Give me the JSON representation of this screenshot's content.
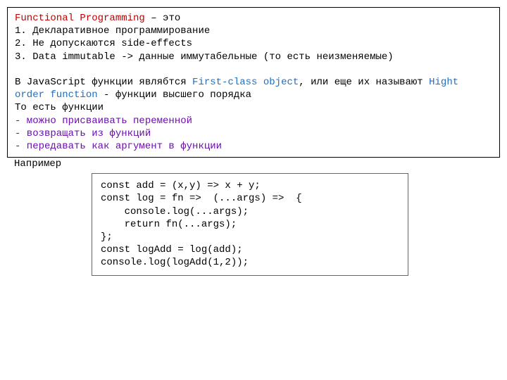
{
  "box1": {
    "title": "Functional Programming",
    "title_suffix": " – это",
    "li1": "1. Декларативное программирование",
    "li2": "2. Не допускаются side-effects",
    "li3": "3. Data immutable -> данные иммутабельные (то есть неизменяемые)",
    "para1_a": "В JavaScript функции являбтся ",
    "fco": "First-class object",
    "para1_b": ", или еще их называют  ",
    "hof": "Hight order function",
    "para1_c": " - функции высшего порядка",
    "para2": "То есть функции",
    "b1": "- можно присваивать переменной",
    "b2": "- возвращать из функций",
    "b3": "- передавать как аргумент в функции"
  },
  "after": "Например",
  "code": {
    "l1": "const add = (x,y) => x + y;",
    "l2": "",
    "l3": "const log = fn =>  (...args) =>  {",
    "l4": "    console.log(...args);",
    "l5": "    return fn(...args);",
    "l6": "};",
    "l7": "",
    "l8": "const logAdd = log(add);",
    "l9": "console.log(logAdd(1,2));"
  }
}
